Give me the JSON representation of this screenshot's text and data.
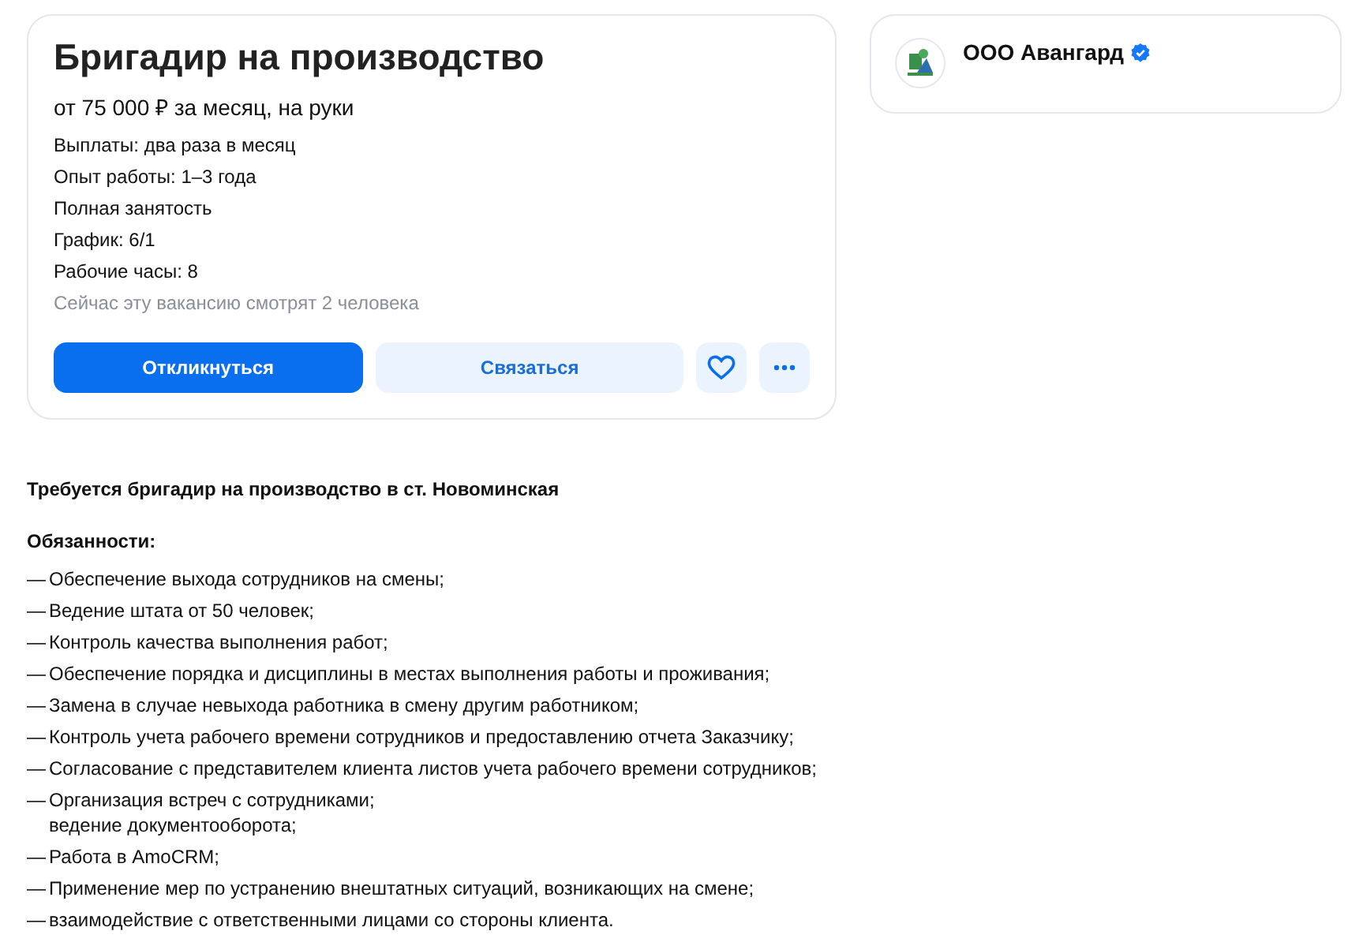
{
  "vacancy": {
    "title": "Бригадир на производство",
    "salary": "от 75 000 ₽ за месяц, на руки",
    "details": [
      "Выплаты: два раза в месяц",
      "Опыт работы: 1–3 года",
      "Полная занятость",
      "График: 6/1",
      "Рабочие часы: 8"
    ],
    "viewers": "Сейчас эту вакансию смотрят 2 человека",
    "buttons": [
      {
        "kind": "primary",
        "label": "Откликнуться"
      },
      {
        "kind": "secondary",
        "label": "Связаться"
      },
      {
        "kind": "favorite"
      },
      {
        "kind": "more"
      }
    ]
  },
  "employer": {
    "name": "ООО Авангард",
    "verified": true
  },
  "description": {
    "intro": "Требуется бригадир на производство в ст. Новоминская",
    "heading": "Обязанности:",
    "items": [
      {
        "marker": "—",
        "lines": [
          "Обеспечение выхода сотрудников на смены;"
        ]
      },
      {
        "marker": "—",
        "lines": [
          "Ведение штата от 50 человек;"
        ]
      },
      {
        "marker": "—",
        "lines": [
          "Контроль качества выполнения работ;"
        ]
      },
      {
        "marker": "—",
        "lines": [
          "Обеспечение порядка и дисциплины в местах выполнения работы и проживания;"
        ]
      },
      {
        "marker": "—",
        "lines": [
          "Замена в случае невыхода работника в смену другим работником;"
        ]
      },
      {
        "marker": "—",
        "lines": [
          "Контроль учета рабочего времени сотрудников и предоставлению отчета Заказчику;"
        ]
      },
      {
        "marker": "—",
        "lines": [
          "Согласование с представителем клиента листов учета рабочего времени сотрудников;"
        ]
      },
      {
        "marker": "—",
        "lines": [
          "Организация встреч с сотрудниками;",
          "ведение документооборота;"
        ]
      },
      {
        "marker": "—",
        "lines": [
          "Работа в AmoCRM;"
        ]
      },
      {
        "marker": "—",
        "lines": [
          "Применение мер по устранению внештатных ситуаций, возникающих на смене;"
        ]
      },
      {
        "marker": "—",
        "lines": [
          "взаимодействие с ответственными лицами со стороны клиента."
        ]
      }
    ]
  }
}
